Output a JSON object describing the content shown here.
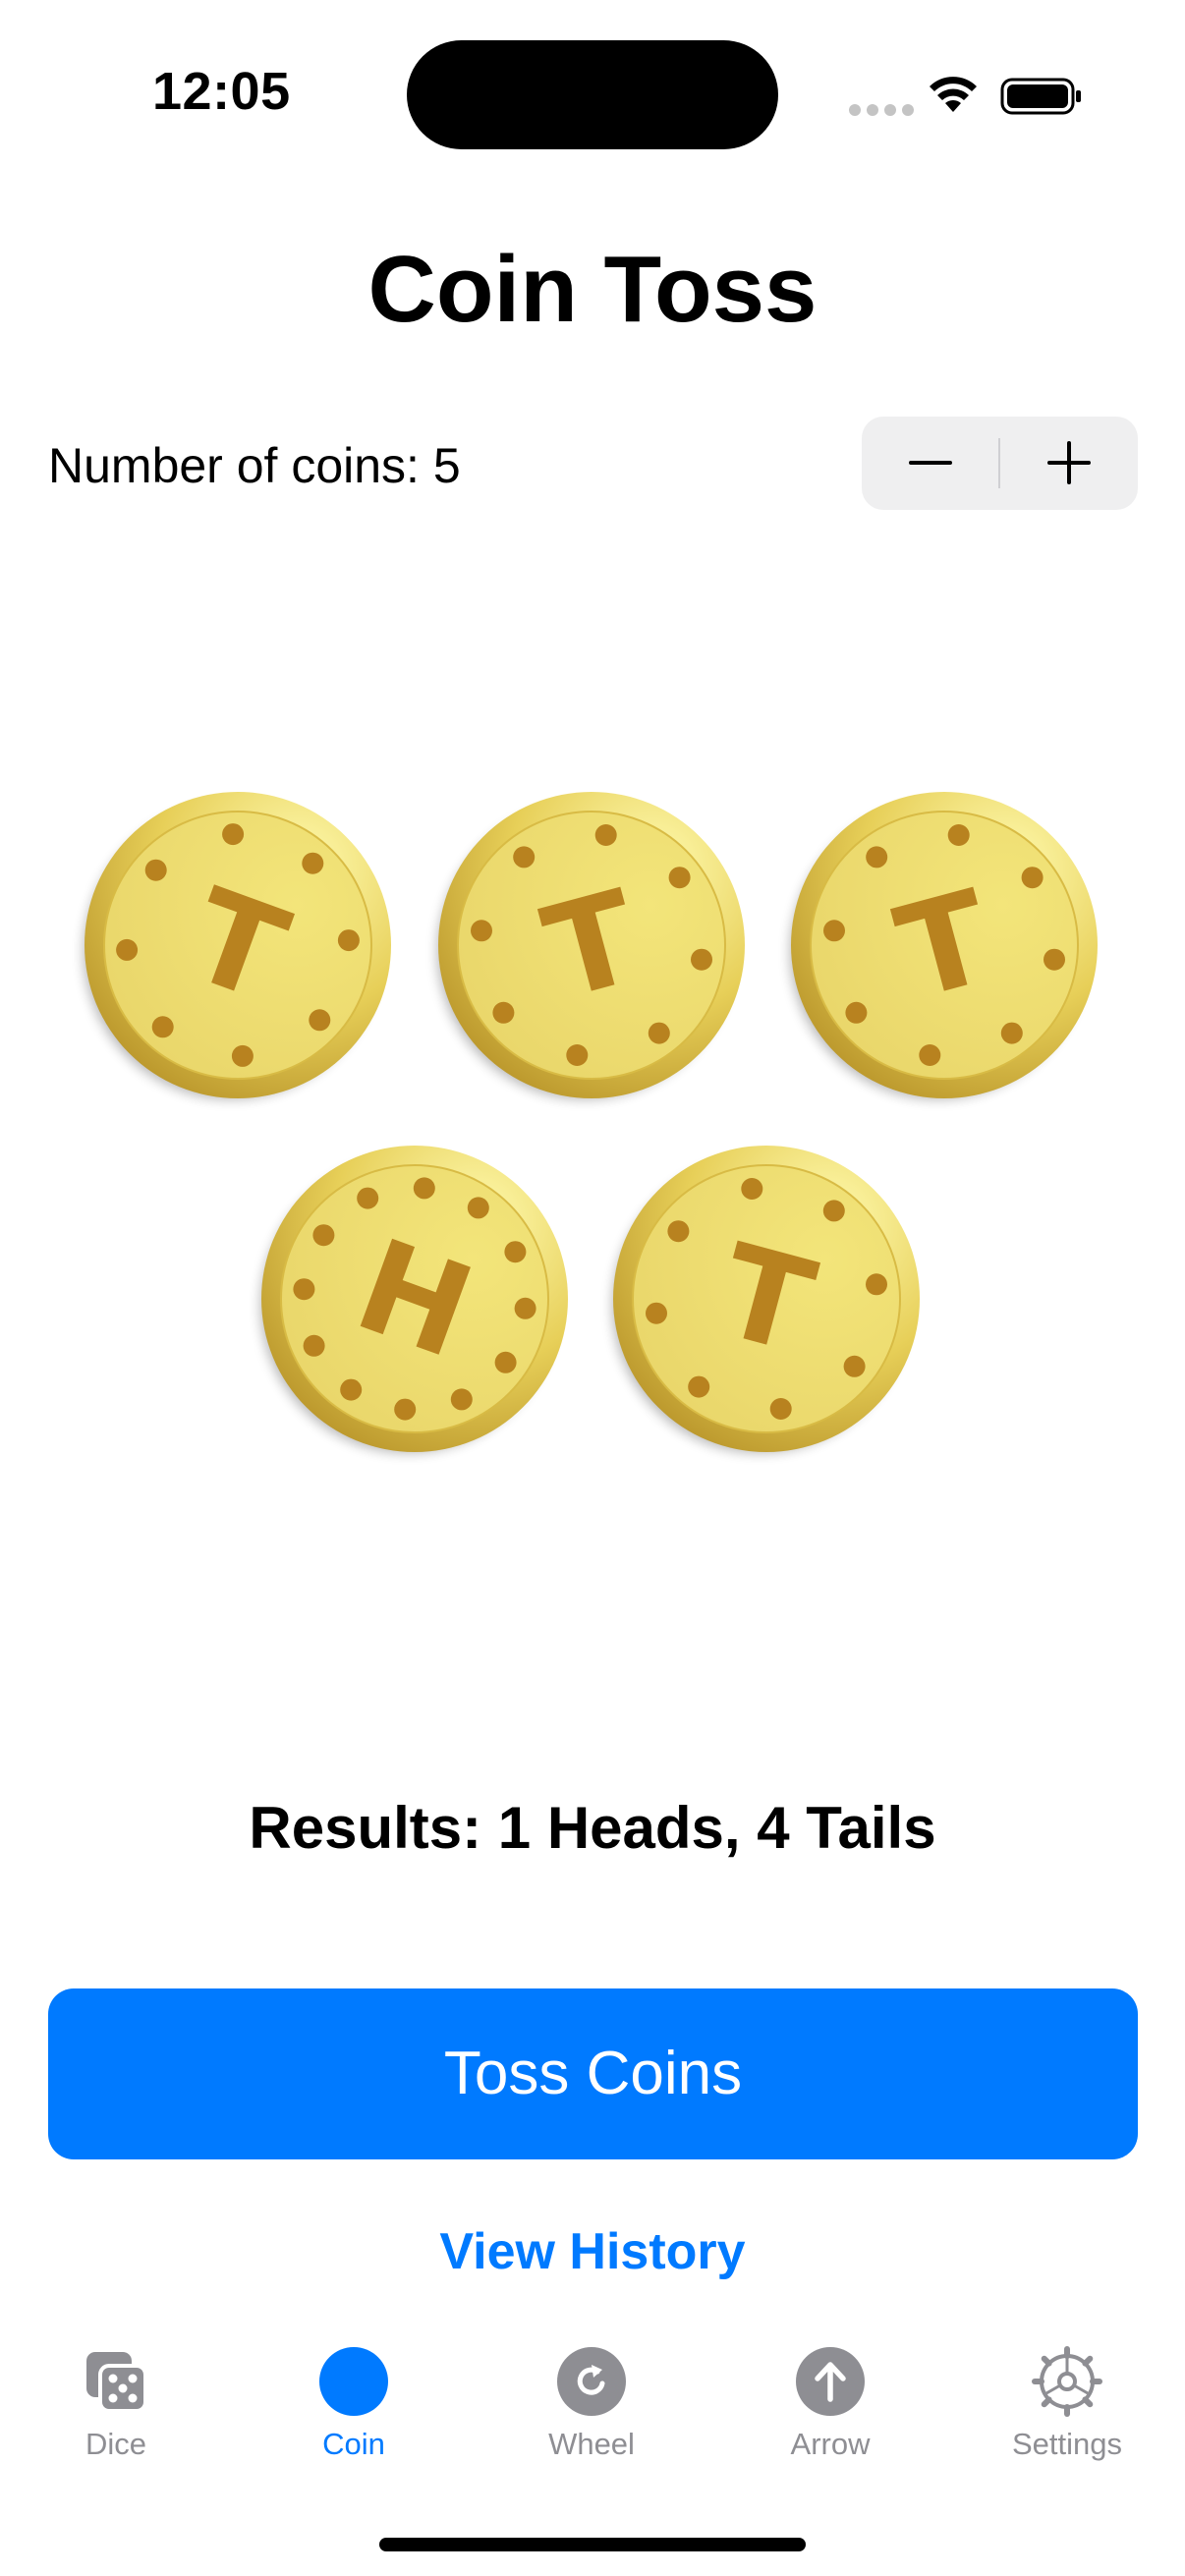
{
  "status_bar": {
    "time": "12:05"
  },
  "title": "Coin Toss",
  "coin_count": {
    "label": "Number of coins: 5",
    "value": 5,
    "decrement_symbol": "minus-icon",
    "increment_symbol": "plus-icon"
  },
  "coins": [
    {
      "face": "T"
    },
    {
      "face": "T"
    },
    {
      "face": "T"
    },
    {
      "face": "H"
    },
    {
      "face": "T"
    }
  ],
  "results": "Results: 1 Heads, 4 Tails",
  "toss_button_label": "Toss Coins",
  "history_link_label": "View History",
  "tabs": [
    {
      "label": "Dice",
      "icon": "dice-icon",
      "active": false
    },
    {
      "label": "Coin",
      "icon": "coin-icon",
      "active": true
    },
    {
      "label": "Wheel",
      "icon": "wheel-icon",
      "active": false
    },
    {
      "label": "Arrow",
      "icon": "arrow-icon",
      "active": false
    },
    {
      "label": "Settings",
      "icon": "gear-icon",
      "active": false
    }
  ],
  "colors": {
    "accent": "#007aff",
    "coin_gold": "#e9d66a",
    "coin_mark": "#b8821f",
    "inactive_tab": "#8e8e93"
  }
}
